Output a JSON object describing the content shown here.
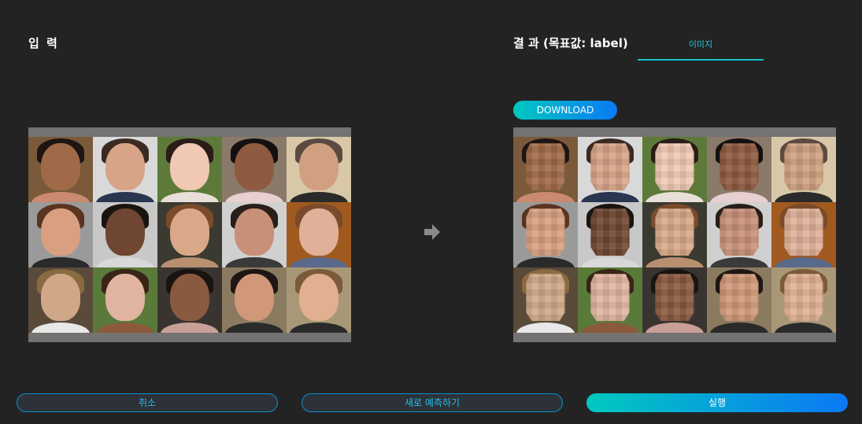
{
  "input_title": "입 력",
  "result_title": "결 과 (목표값: label)",
  "tabs": [
    "이미지"
  ],
  "download_label": "DOWNLOAD",
  "buttons": {
    "cancel": "취소",
    "repredict": "새로 예측하기",
    "run": "실행"
  },
  "colors": {
    "accent_start": "#00c9c0",
    "accent_end": "#0a79f5",
    "tab_underline": "#14c3cb"
  },
  "icons": {
    "arrow": "arrow-right-icon"
  },
  "images": {
    "input": "face-grid-original",
    "output": "face-grid-pixelated",
    "faces": [
      {
        "bg": "#7a5a3a",
        "skin": "#a06a48",
        "hair": "#1e1512",
        "cloth": "#c98a70"
      },
      {
        "bg": "#d9d9d9",
        "skin": "#d7a488",
        "hair": "#3a2a22",
        "cloth": "#2a3550"
      },
      {
        "bg": "#5d7a3a",
        "skin": "#f0c8b4",
        "hair": "#2a1c16",
        "cloth": "#e8e0d8"
      },
      {
        "bg": "#8a7a6a",
        "skin": "#8e5a40",
        "hair": "#141010",
        "cloth": "#e8d0d0"
      },
      {
        "bg": "#d8c8a8",
        "skin": "#d0a080",
        "hair": "#5a4a40",
        "cloth": "#2a2a2a"
      },
      {
        "bg": "#9a9a9a",
        "skin": "#d8a080",
        "hair": "#5a3420",
        "cloth": "#2a2a2a"
      },
      {
        "bg": "#c8c8c8",
        "skin": "#6e4632",
        "hair": "#1a1410",
        "cloth": "#d8d8d8"
      },
      {
        "bg": "#3a3a30",
        "skin": "#d8a888",
        "hair": "#7a4a2a",
        "cloth": "#b89070"
      },
      {
        "bg": "#d0d0d0",
        "skin": "#c89078",
        "hair": "#2a1e18",
        "cloth": "#3a3a3a"
      },
      {
        "bg": "#a05a20",
        "skin": "#e0b098",
        "hair": "#7a4a2a",
        "cloth": "#5a6a8a"
      },
      {
        "bg": "#5a4a3a",
        "skin": "#d0a888",
        "hair": "#8a6a40",
        "cloth": "#e8e8e8"
      },
      {
        "bg": "#5a7a3a",
        "skin": "#e0b4a0",
        "hair": "#3a2418",
        "cloth": "#8a5a3a"
      },
      {
        "bg": "#3a3430",
        "skin": "#8a5a40",
        "hair": "#1a1410",
        "cloth": "#c8a098"
      },
      {
        "bg": "#8a7a60",
        "skin": "#d09878",
        "hair": "#1e1612",
        "cloth": "#2a2a2a"
      },
      {
        "bg": "#a89878",
        "skin": "#e0b090",
        "hair": "#7a5a3a",
        "cloth": "#2a2a2a"
      }
    ]
  }
}
